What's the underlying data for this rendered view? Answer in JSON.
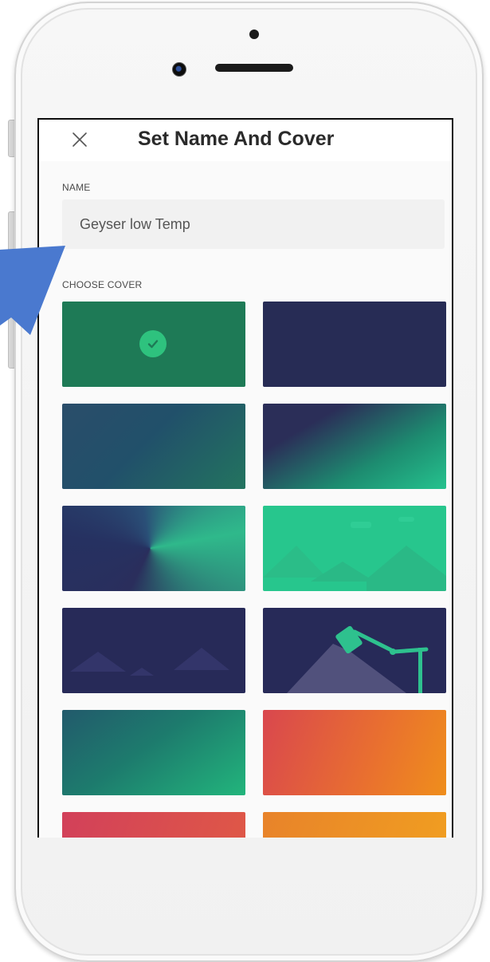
{
  "header": {
    "title": "Set Name And Cover",
    "close_icon": "close-icon"
  },
  "name_section": {
    "label": "NAME",
    "value": "Geyser low Temp"
  },
  "cover_section": {
    "label": "CHOOSE COVER",
    "selected_index": 0,
    "covers": [
      {
        "id": "solid-green",
        "selected": true
      },
      {
        "id": "solid-navy",
        "selected": false
      },
      {
        "id": "gradient-teal-navy",
        "selected": false
      },
      {
        "id": "gradient-navy-green-diagonal",
        "selected": false
      },
      {
        "id": "conic-navy-green",
        "selected": false
      },
      {
        "id": "green-mountains",
        "selected": false
      },
      {
        "id": "navy-mountains",
        "selected": false
      },
      {
        "id": "navy-lamp",
        "selected": false
      },
      {
        "id": "gradient-teal-green",
        "selected": false
      },
      {
        "id": "gradient-red-orange",
        "selected": false
      },
      {
        "id": "gradient-pink-red",
        "selected": false
      },
      {
        "id": "gradient-orange-yellow",
        "selected": false
      }
    ]
  },
  "colors": {
    "accent_green": "#1e7a56",
    "navy": "#272c55",
    "check_green": "#2ec27e",
    "pointer_blue": "#4a79cf"
  }
}
